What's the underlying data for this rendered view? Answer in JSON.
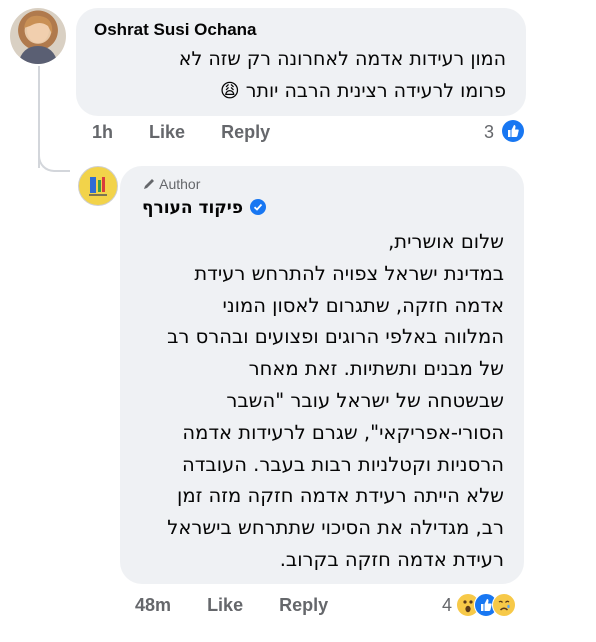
{
  "comment1": {
    "author": "Oshrat Susi Ochana",
    "line1": "המון רעידות אדמה לאחרונה  רק שזה לא",
    "line2": "פרומו לרעידה רצינית הרבה יותר",
    "emoji": "😩",
    "time": "1h",
    "like_label": "Like",
    "reply_label": "Reply",
    "reaction_count": "3",
    "reaction_icon": "like-icon"
  },
  "comment2": {
    "author_badge": "Author",
    "author": "פיקוד העורף",
    "verified_icon": "verified-badge-icon",
    "lines": [
      "שלום אושרית,",
      "במדינת ישראל צפויה להתרחש רעידת",
      "אדמה חזקה, שתגרום לאסון המוני",
      "המלווה באלפי הרוגים ופצועים ובהרס רב",
      "של מבנים ותשתיות. זאת מאחר",
      "שבשטחה של ישראל עובר \"השבר",
      "הסורי-אפריקאי\", שגרם לרעידות אדמה",
      "הרסניות וקטלניות רבות בעבר. העובדה",
      "שלא הייתה רעידת אדמה חזקה מזה זמן",
      "רב, מגדילה את הסיכוי שתתרחש בישראל",
      "רעידת אדמה חזקה בקרוב."
    ],
    "time": "48m",
    "like_label": "Like",
    "reply_label": "Reply",
    "reaction_count": "4",
    "reaction_icons": [
      "wow-icon",
      "like-icon",
      "sad-icon"
    ]
  },
  "colors": {
    "bubble": "#eff1f4",
    "meta_text": "#65676b",
    "like_blue": "#1877f2",
    "thread_line": "#d3d6db"
  }
}
